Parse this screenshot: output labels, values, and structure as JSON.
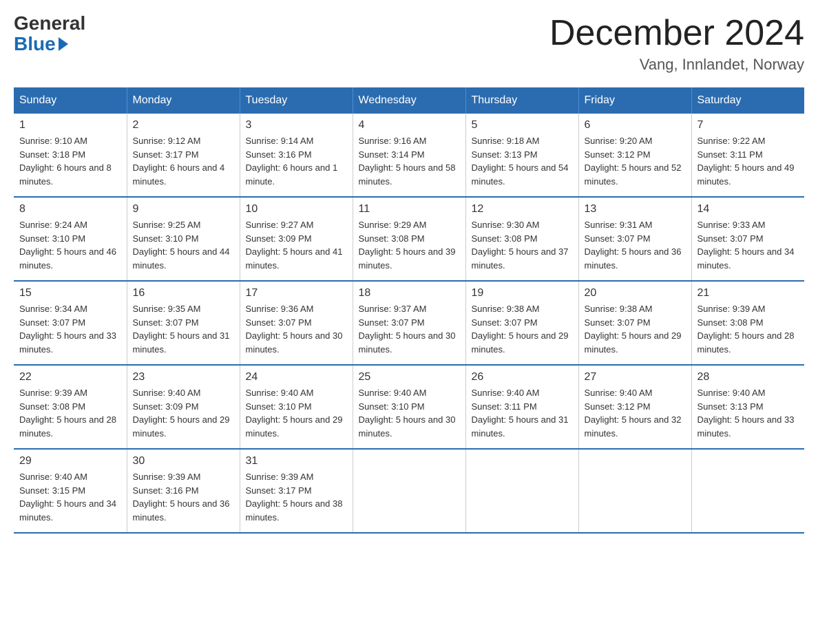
{
  "logo": {
    "general": "General",
    "blue": "Blue"
  },
  "header": {
    "month": "December 2024",
    "location": "Vang, Innlandet, Norway"
  },
  "days_of_week": [
    "Sunday",
    "Monday",
    "Tuesday",
    "Wednesday",
    "Thursday",
    "Friday",
    "Saturday"
  ],
  "weeks": [
    [
      {
        "day": "1",
        "sunrise": "9:10 AM",
        "sunset": "3:18 PM",
        "daylight": "6 hours and 8 minutes."
      },
      {
        "day": "2",
        "sunrise": "9:12 AM",
        "sunset": "3:17 PM",
        "daylight": "6 hours and 4 minutes."
      },
      {
        "day": "3",
        "sunrise": "9:14 AM",
        "sunset": "3:16 PM",
        "daylight": "6 hours and 1 minute."
      },
      {
        "day": "4",
        "sunrise": "9:16 AM",
        "sunset": "3:14 PM",
        "daylight": "5 hours and 58 minutes."
      },
      {
        "day": "5",
        "sunrise": "9:18 AM",
        "sunset": "3:13 PM",
        "daylight": "5 hours and 54 minutes."
      },
      {
        "day": "6",
        "sunrise": "9:20 AM",
        "sunset": "3:12 PM",
        "daylight": "5 hours and 52 minutes."
      },
      {
        "day": "7",
        "sunrise": "9:22 AM",
        "sunset": "3:11 PM",
        "daylight": "5 hours and 49 minutes."
      }
    ],
    [
      {
        "day": "8",
        "sunrise": "9:24 AM",
        "sunset": "3:10 PM",
        "daylight": "5 hours and 46 minutes."
      },
      {
        "day": "9",
        "sunrise": "9:25 AM",
        "sunset": "3:10 PM",
        "daylight": "5 hours and 44 minutes."
      },
      {
        "day": "10",
        "sunrise": "9:27 AM",
        "sunset": "3:09 PM",
        "daylight": "5 hours and 41 minutes."
      },
      {
        "day": "11",
        "sunrise": "9:29 AM",
        "sunset": "3:08 PM",
        "daylight": "5 hours and 39 minutes."
      },
      {
        "day": "12",
        "sunrise": "9:30 AM",
        "sunset": "3:08 PM",
        "daylight": "5 hours and 37 minutes."
      },
      {
        "day": "13",
        "sunrise": "9:31 AM",
        "sunset": "3:07 PM",
        "daylight": "5 hours and 36 minutes."
      },
      {
        "day": "14",
        "sunrise": "9:33 AM",
        "sunset": "3:07 PM",
        "daylight": "5 hours and 34 minutes."
      }
    ],
    [
      {
        "day": "15",
        "sunrise": "9:34 AM",
        "sunset": "3:07 PM",
        "daylight": "5 hours and 33 minutes."
      },
      {
        "day": "16",
        "sunrise": "9:35 AM",
        "sunset": "3:07 PM",
        "daylight": "5 hours and 31 minutes."
      },
      {
        "day": "17",
        "sunrise": "9:36 AM",
        "sunset": "3:07 PM",
        "daylight": "5 hours and 30 minutes."
      },
      {
        "day": "18",
        "sunrise": "9:37 AM",
        "sunset": "3:07 PM",
        "daylight": "5 hours and 30 minutes."
      },
      {
        "day": "19",
        "sunrise": "9:38 AM",
        "sunset": "3:07 PM",
        "daylight": "5 hours and 29 minutes."
      },
      {
        "day": "20",
        "sunrise": "9:38 AM",
        "sunset": "3:07 PM",
        "daylight": "5 hours and 29 minutes."
      },
      {
        "day": "21",
        "sunrise": "9:39 AM",
        "sunset": "3:08 PM",
        "daylight": "5 hours and 28 minutes."
      }
    ],
    [
      {
        "day": "22",
        "sunrise": "9:39 AM",
        "sunset": "3:08 PM",
        "daylight": "5 hours and 28 minutes."
      },
      {
        "day": "23",
        "sunrise": "9:40 AM",
        "sunset": "3:09 PM",
        "daylight": "5 hours and 29 minutes."
      },
      {
        "day": "24",
        "sunrise": "9:40 AM",
        "sunset": "3:10 PM",
        "daylight": "5 hours and 29 minutes."
      },
      {
        "day": "25",
        "sunrise": "9:40 AM",
        "sunset": "3:10 PM",
        "daylight": "5 hours and 30 minutes."
      },
      {
        "day": "26",
        "sunrise": "9:40 AM",
        "sunset": "3:11 PM",
        "daylight": "5 hours and 31 minutes."
      },
      {
        "day": "27",
        "sunrise": "9:40 AM",
        "sunset": "3:12 PM",
        "daylight": "5 hours and 32 minutes."
      },
      {
        "day": "28",
        "sunrise": "9:40 AM",
        "sunset": "3:13 PM",
        "daylight": "5 hours and 33 minutes."
      }
    ],
    [
      {
        "day": "29",
        "sunrise": "9:40 AM",
        "sunset": "3:15 PM",
        "daylight": "5 hours and 34 minutes."
      },
      {
        "day": "30",
        "sunrise": "9:39 AM",
        "sunset": "3:16 PM",
        "daylight": "5 hours and 36 minutes."
      },
      {
        "day": "31",
        "sunrise": "9:39 AM",
        "sunset": "3:17 PM",
        "daylight": "5 hours and 38 minutes."
      },
      null,
      null,
      null,
      null
    ]
  ]
}
